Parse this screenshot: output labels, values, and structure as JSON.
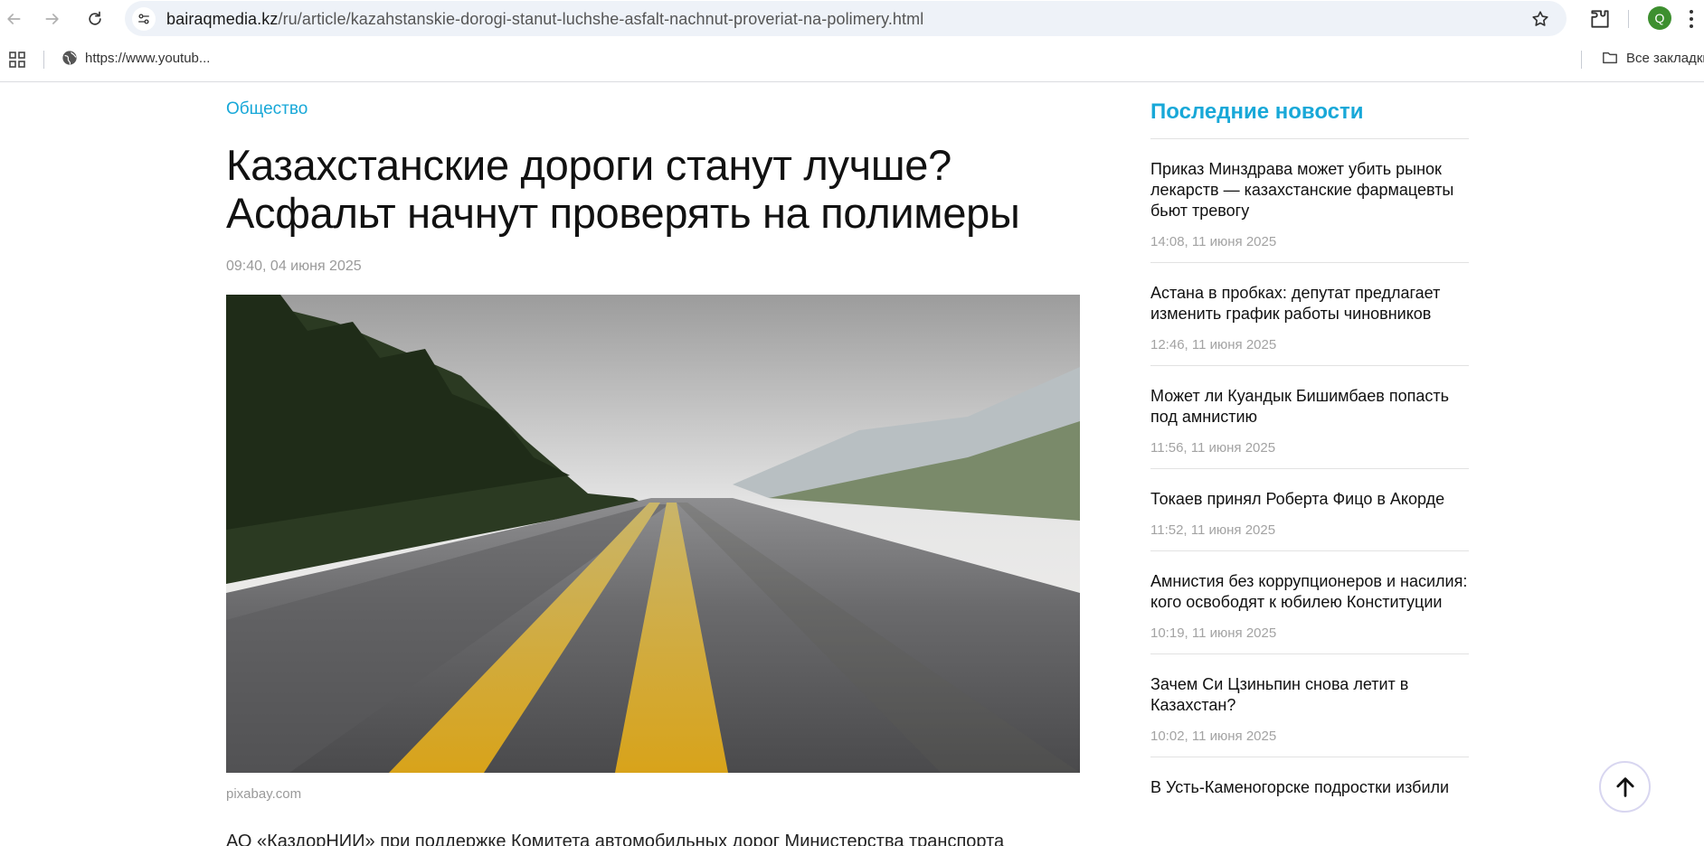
{
  "browser": {
    "url_host": "bairaqmedia.kz",
    "url_path": "/ru/article/kazahstanskie-dorogi-stanut-luchshe-asfalt-nachnut-proveriat-na-polimery.html",
    "avatar_letter": "Q",
    "bookmark_item": "https://www.youtub...",
    "bookmark_all": "Все закладки"
  },
  "article": {
    "category": "Общество",
    "title": "Казахстанские дороги станут лучше? Асфальт начнут проверять на полимеры",
    "date": "09:40, 04 июня 2025",
    "image_credit": "pixabay.com",
    "lead": "АО «КаздорНИИ» при поддержке Комитета автомобильных дорог Министерства транспорта"
  },
  "sidebar": {
    "heading": "Последние новости",
    "items": [
      {
        "title": "Приказ Минздрава может убить рынок лекарств — казахстанские фармацевты бьют тревогу",
        "time": "14:08, 11 июня 2025"
      },
      {
        "title": "Астана в пробках: депутат предлагает изменить график работы чиновников",
        "time": "12:46, 11 июня 2025"
      },
      {
        "title": "Может ли Куандык Бишимбаев попасть под амнистию",
        "time": "11:56, 11 июня 2025"
      },
      {
        "title": "Токаев принял Роберта Фицо в Акорде",
        "time": "11:52, 11 июня 2025"
      },
      {
        "title": "Амнистия без коррупционеров и насилия: кого освободят к юбилею Конституции",
        "time": "10:19, 11 июня 2025"
      },
      {
        "title": "Зачем Си Цзиньпин снова летит в Казахстан?",
        "time": "10:02, 11 июня 2025"
      },
      {
        "title": "В Усть-Каменогорске подростки избили",
        "time": ""
      }
    ]
  },
  "colors": {
    "accent": "#18a8d8",
    "meta_gray": "#9a9a9a"
  }
}
